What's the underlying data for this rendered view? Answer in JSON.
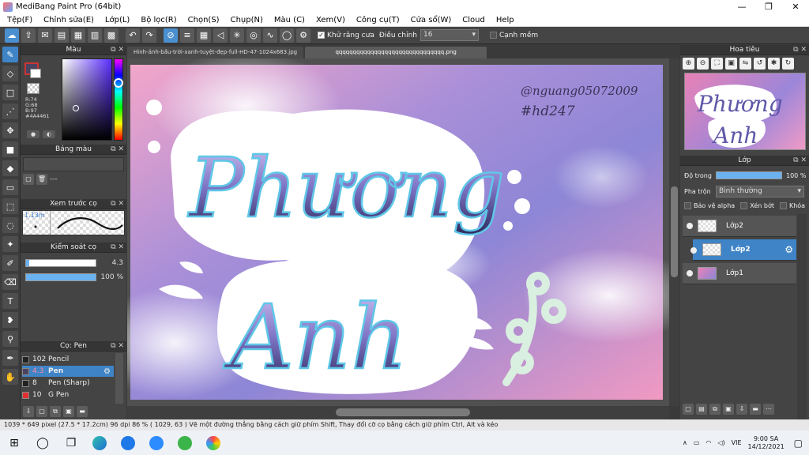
{
  "window": {
    "title": "MediBang Paint Pro (64bit)",
    "controls": [
      "—",
      "❐",
      "✕"
    ]
  },
  "menu": [
    "Tệp(F)",
    "Chỉnh sửa(E)",
    "Lớp(L)",
    "Bộ lọc(R)",
    "Chọn(S)",
    "Chụp(N)",
    "Màu (C)",
    "Xem(V)",
    "Công cụ(T)",
    "Cửa sổ(W)",
    "Cloud",
    "Help"
  ],
  "toolbar": {
    "antialias_label": "Khử răng cưa",
    "adjust_label": "Điều chỉnh",
    "adjust_value": "16",
    "snap_label": "Cạnh mềm"
  },
  "color_panel": {
    "title": "Màu",
    "rgb_text": "R:74\nG:68\nB:97\n#4A4461",
    "accent": "#4a4461"
  },
  "palette_panel": {
    "title": "Bảng màu",
    "dash": "---"
  },
  "brush_preview": {
    "title": "Xem trước cọ",
    "size": "1.13m"
  },
  "brush_control": {
    "title": "Kiểm soát cọ",
    "size_value": "4.3",
    "opacity_value": "100 %",
    "opacity_pct": 100,
    "size_pct": 100
  },
  "brush_list": {
    "title": "Cọ: Pen",
    "items": [
      {
        "num": "102",
        "name": "Pencil",
        "selected": false,
        "color": "#222222"
      },
      {
        "num": "4.3",
        "name": "Pen",
        "selected": true,
        "color": "#4a4461"
      },
      {
        "num": "8",
        "name": "Pen (Sharp)",
        "selected": false,
        "color": "#222222"
      },
      {
        "num": "10",
        "name": "G Pen",
        "selected": false,
        "color": "#e03030"
      }
    ]
  },
  "tabs": [
    {
      "label": "Hình-ảnh-bầu-trời-xanh-tuyệt-đẹp-full-HD-47-1024x683.jpg",
      "active": false
    },
    {
      "label": "qqqqqqqqqqqqqqqqqqqqqqqqqqqqqqq.png",
      "active": true
    }
  ],
  "canvas": {
    "signature_line1": "@nguang05072009",
    "signature_line2": "#hd247",
    "word1": "Phương",
    "word2": "Anh"
  },
  "navigator": {
    "title": "Hoa tiêu"
  },
  "layer_panel": {
    "title": "Lớp",
    "opacity_label": "Độ trong",
    "opacity_value": "100 %",
    "opacity_pct": 100,
    "blend_label": "Pha trộn",
    "blend_value": "Bình thường",
    "protect_alpha": "Bảo vệ alpha",
    "clipping": "Xén bớt",
    "lock": "Khóa",
    "layers": [
      {
        "name": "Lớp2",
        "selected": false
      },
      {
        "name": "Lớp2",
        "selected": true
      },
      {
        "name": "Lớp1",
        "selected": false
      }
    ]
  },
  "status": {
    "text": "1039 * 649 pixel   (27.5 * 17.2cm)   96 dpi   86 %   ( 1029, 63 )   Vẽ một đường thẳng bằng cách giữ phím Shift, Thay đổi cỡ cọ bằng cách giữ phím Ctrl, Alt và kéo"
  },
  "taskbar": {
    "lang": "VIE",
    "time": "9:00 SA",
    "date": "14/12/2021"
  }
}
